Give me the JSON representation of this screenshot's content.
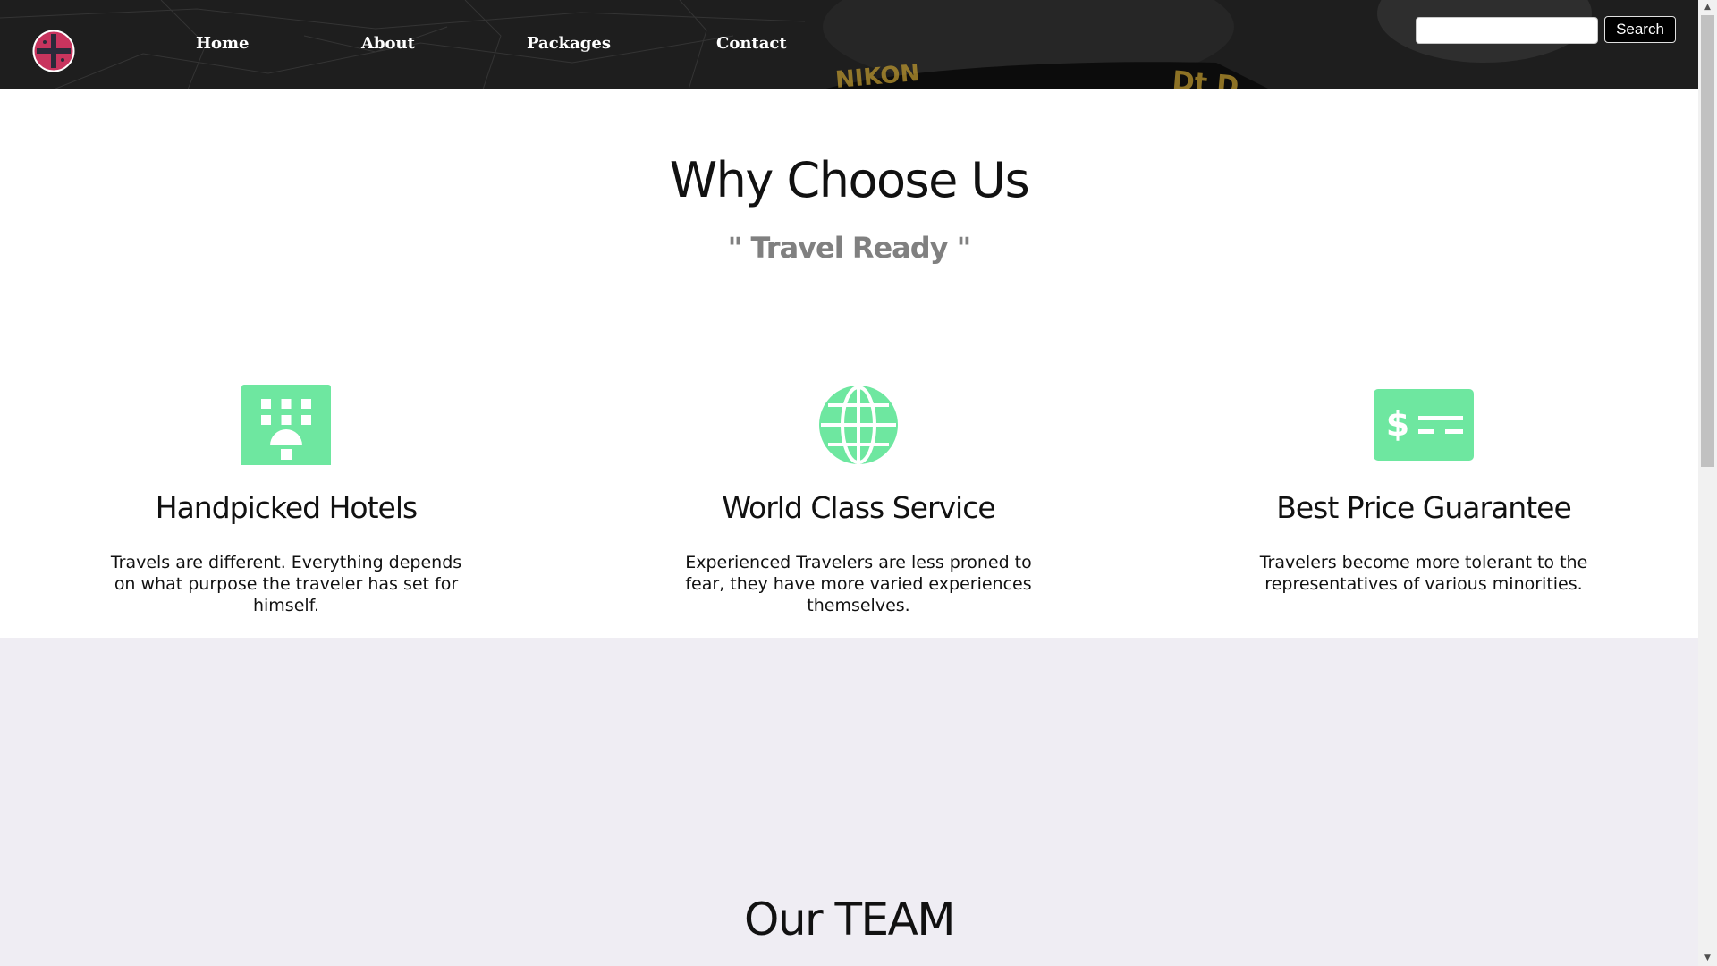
{
  "header": {
    "logo_icon": "travel-compass-logo",
    "nav": [
      {
        "label": "Home"
      },
      {
        "label": "About"
      },
      {
        "label": "Packages"
      },
      {
        "label": "Contact"
      }
    ],
    "search": {
      "placeholder": "",
      "value": "",
      "button_label": "Search"
    }
  },
  "why_choose_us": {
    "title": "Why Choose Us",
    "tagline": "\" Travel Ready \"",
    "features": [
      {
        "icon": "hotel-icon",
        "title": "Handpicked Hotels",
        "text": "Travels are different. Everything depends on what purpose the traveler has set for himself."
      },
      {
        "icon": "globe-icon",
        "title": "World Class Service",
        "text": "Experienced Travelers are less proned to fear, they have more varied experiences themselves."
      },
      {
        "icon": "money-bill-icon",
        "title": "Best Price Guarantee",
        "text": "Travelers become more tolerant to the representatives of various minorities."
      }
    ]
  },
  "team": {
    "title": "Our TEAM"
  },
  "scrollbar": {
    "up_icon": "scroll-up-arrow-icon",
    "down_icon": "scroll-down-arrow-icon"
  },
  "colors": {
    "accent": "#6ee7a0",
    "logo_fill": "#c8345e",
    "header_bg": "#1c1c1c",
    "team_bg": "#efedf3",
    "tagline": "#808080"
  }
}
